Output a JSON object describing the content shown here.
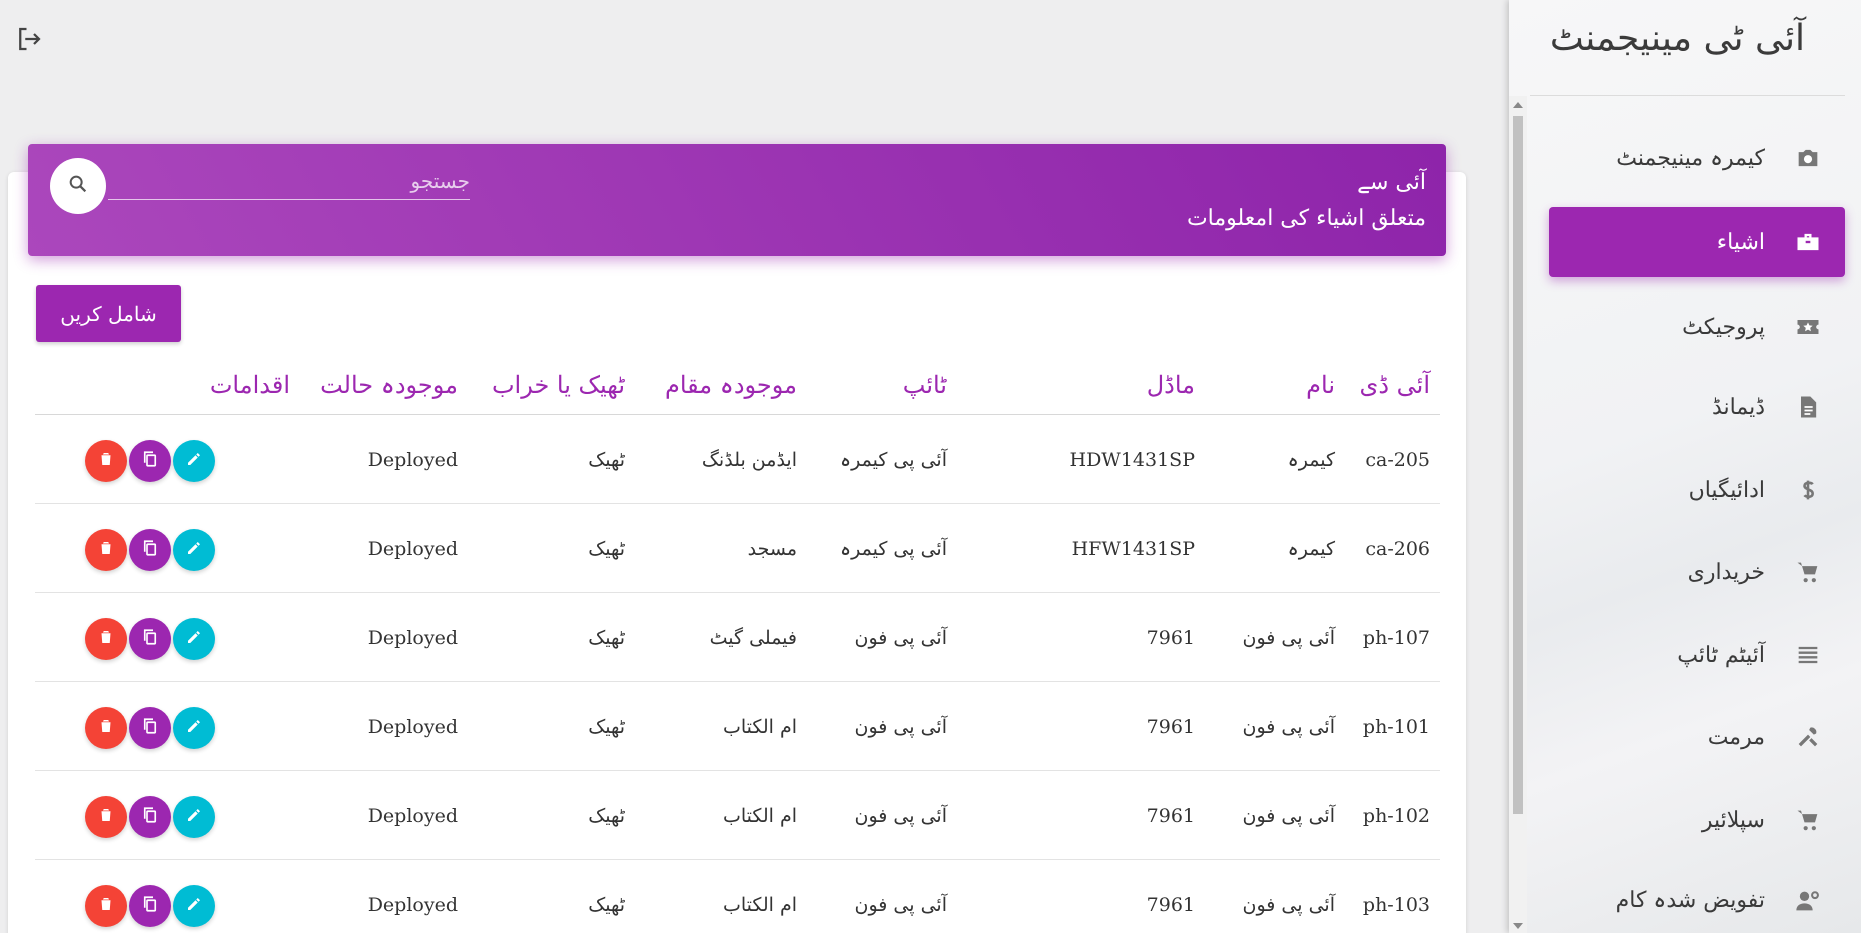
{
  "app": {
    "title": "آئی ٹی مینیجمنٹ"
  },
  "sidebar": {
    "items": [
      {
        "label": "کیمرہ مینیجمنٹ",
        "icon": "camera-icon",
        "active": false
      },
      {
        "label": "اشیاء",
        "icon": "briefcase-icon",
        "active": true
      },
      {
        "label": "پروجیکٹ",
        "icon": "ticket-icon",
        "active": false
      },
      {
        "label": "ڈیمانڈ",
        "icon": "document-icon",
        "active": false
      },
      {
        "label": "ادائیگیاں",
        "icon": "dollar-icon",
        "active": false
      },
      {
        "label": "خریداری",
        "icon": "cart-icon",
        "active": false
      },
      {
        "label": "آئیٹم ٹائپ",
        "icon": "list-icon",
        "active": false
      },
      {
        "label": "مرمت",
        "icon": "tools-icon",
        "active": false
      },
      {
        "label": "سپلائیر",
        "icon": "cart-icon",
        "active": false
      },
      {
        "label": "تفویض شدہ کام",
        "icon": "user-gear-icon",
        "active": false
      }
    ]
  },
  "header": {
    "title_line1": "آئی سے",
    "title_line2": "متعلق اشیاء کی امعلومات",
    "search_placeholder": "جستجو"
  },
  "toolbar": {
    "add_label": "شامل کریں"
  },
  "table": {
    "columns": [
      "آئی ڈی",
      "نام",
      "ماڈل",
      "ٹائپ",
      "موجودہ مقام",
      "ٹھیک یا خراب",
      "موجودہ حالت",
      "اقدامات"
    ],
    "rows": [
      {
        "id": "ca-205",
        "name": "کیمرہ",
        "model": "HDW1431SP",
        "type": "آئی پی کیمرہ",
        "location": "ایڈمن بلڈنگ",
        "condition": "ٹھیک",
        "status": "Deployed"
      },
      {
        "id": "ca-206",
        "name": "کیمرہ",
        "model": "HFW1431SP",
        "type": "آئی پی کیمرہ",
        "location": "مسجد",
        "condition": "ٹھیک",
        "status": "Deployed"
      },
      {
        "id": "ph-107",
        "name": "آئی پی فون",
        "model": "7961",
        "type": "آئی پی فون",
        "location": "فیملی گیٹ",
        "condition": "ٹھیک",
        "status": "Deployed"
      },
      {
        "id": "ph-101",
        "name": "آئی پی فون",
        "model": "7961",
        "type": "آئی پی فون",
        "location": "ام الکتاب",
        "condition": "ٹھیک",
        "status": "Deployed"
      },
      {
        "id": "ph-102",
        "name": "آئی پی فون",
        "model": "7961",
        "type": "آئی پی فون",
        "location": "ام الکتاب",
        "condition": "ٹھیک",
        "status": "Deployed"
      },
      {
        "id": "ph-103",
        "name": "آئی پی فون",
        "model": "7961",
        "type": "آئی پی فون",
        "location": "ام الکتاب",
        "condition": "ٹھیک",
        "status": "Deployed"
      }
    ]
  },
  "colors": {
    "accent": "#9c27b0",
    "delete": "#f44336",
    "edit": "#00bcd4"
  }
}
